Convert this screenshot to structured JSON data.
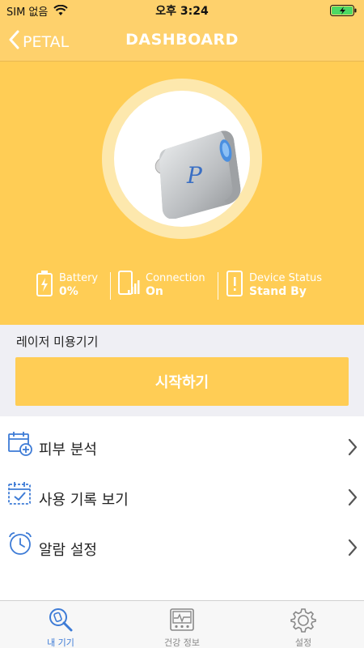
{
  "status_bar": {
    "carrier": "SIM 없음",
    "time": "오후 3:24",
    "wifi_icon": "wifi-icon",
    "battery_icon": "battery-icon"
  },
  "nav": {
    "back_label": "PETAL",
    "title": "DASHBOARD"
  },
  "hero": {
    "background_color": "#ffcd55",
    "stats": [
      {
        "label": "Battery",
        "value": "0%",
        "icon": "battery-charging-icon"
      },
      {
        "label": "Connection",
        "value": "On",
        "icon": "phone-signal-icon"
      },
      {
        "label": "Device Status",
        "value": "Stand By",
        "icon": "alert-icon"
      }
    ]
  },
  "device_section": {
    "label": "레이저 미용기기",
    "start_label": "시작하기"
  },
  "menu": [
    {
      "label": "피부 분석",
      "icon": "calendar-add-icon"
    },
    {
      "label": "사용 기록 보기",
      "icon": "calendar-check-icon"
    },
    {
      "label": "알람 설정",
      "icon": "alarm-clock-icon"
    }
  ],
  "tabs": [
    {
      "label": "내 기기",
      "icon": "search-device-icon",
      "active": true
    },
    {
      "label": "건강 정보",
      "icon": "health-monitor-icon",
      "active": false
    },
    {
      "label": "설정",
      "icon": "gear-icon",
      "active": false
    }
  ],
  "colors": {
    "accent": "#ffcd55",
    "active_tab": "#3d7bd6",
    "icon_blue": "#3d7bd6"
  }
}
